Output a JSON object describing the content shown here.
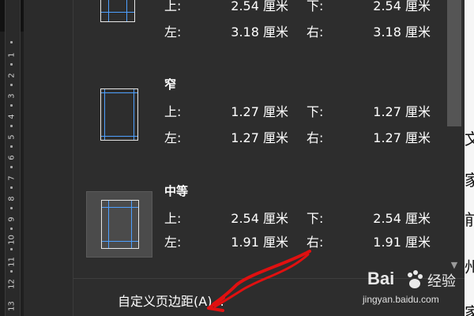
{
  "ruler": {
    "numbers": [
      "1",
      "2",
      "3",
      "4",
      "5",
      "6",
      "7",
      "8",
      "9",
      "10",
      "11",
      "12",
      "13"
    ]
  },
  "margins": [
    {
      "title": "",
      "top_label": "上:",
      "top_value": "2.54 厘米",
      "bottom_label": "下:",
      "bottom_value": "2.54 厘米",
      "left_label": "左:",
      "left_value": "3.18 厘米",
      "right_label": "右:",
      "right_value": "3.18 厘米",
      "selected": false
    },
    {
      "title": "窄",
      "top_label": "上:",
      "top_value": "1.27 厘米",
      "bottom_label": "下:",
      "bottom_value": "1.27 厘米",
      "left_label": "左:",
      "left_value": "1.27 厘米",
      "right_label": "右:",
      "right_value": "1.27 厘米",
      "selected": false
    },
    {
      "title": "中等",
      "top_label": "上:",
      "top_value": "2.54 厘米",
      "bottom_label": "下:",
      "bottom_value": "2.54 厘米",
      "left_label": "左:",
      "left_value": "1.91 厘米",
      "right_label": "右:",
      "right_value": "1.91 厘米",
      "selected": true
    }
  ],
  "custom_margins_label": "自定义页边距(A)...",
  "document_peek": [
    "文",
    "家",
    "前",
    "州",
    "家"
  ],
  "watermark": {
    "brand": "Bai",
    "brand_suffix": "经验",
    "site": "jingyan.baidu.com"
  },
  "colors": {
    "panel_bg": "#2d2d2d",
    "guide_line": "#4ea0ff",
    "annotation": "#e01010",
    "selected_bg": "#4b4b4b"
  }
}
